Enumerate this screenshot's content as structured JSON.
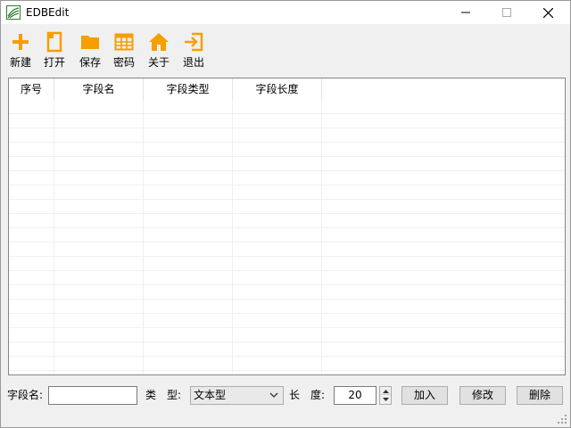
{
  "window": {
    "title": "EDBEdit",
    "brand_color": "#2e7d32",
    "icon_color": "#f59f00"
  },
  "toolbar": {
    "items": [
      {
        "label": "新建",
        "icon": "plus-icon"
      },
      {
        "label": "打开",
        "icon": "document-icon"
      },
      {
        "label": "保存",
        "icon": "folder-icon"
      },
      {
        "label": "密码",
        "icon": "grid-icon"
      },
      {
        "label": "关于",
        "icon": "home-icon"
      },
      {
        "label": "退出",
        "icon": "exit-icon"
      }
    ]
  },
  "grid": {
    "columns": [
      "序号",
      "字段名",
      "字段类型",
      "字段长度"
    ],
    "rows": []
  },
  "form": {
    "field_name_label": "字段名:",
    "field_name_value": "",
    "type_label": "类　型:",
    "type_value": "文本型",
    "length_label": "长　度:",
    "length_value": "20",
    "add_label": "加入",
    "modify_label": "修改",
    "delete_label": "删除"
  }
}
